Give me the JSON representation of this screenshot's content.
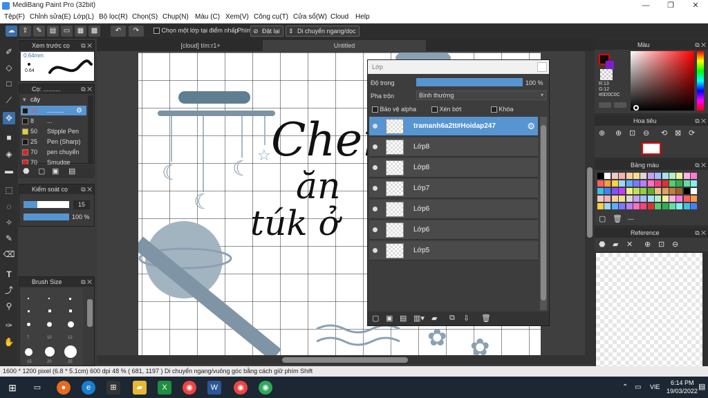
{
  "window": {
    "title": "MediBang Paint Pro (32bit)",
    "minimize": "—",
    "maximize": "❐",
    "close": "✕"
  },
  "menu": [
    "Tệp(F)",
    "Chỉnh sửa(E)",
    "Lớp(L)",
    "Bộ lọc(R)",
    "Chọn(S)",
    "Chụp(N)",
    "Màu (C)",
    "Xem(V)",
    "Công cụ(T)",
    "Cửa sổ(W)",
    "Cloud",
    "Help"
  ],
  "toolbar": {
    "select_layer_label": "Chọn một lớp tại điểm nhấp",
    "key_label": "Phím",
    "reset_label": "Đặt lại",
    "move_label": "Di chuyển ngang/dọc"
  },
  "brush_preview": {
    "title": "Xem trước cọ",
    "size": "0.64mm",
    "dot": "0.64"
  },
  "brush_list": {
    "title": "Cọ: ..........",
    "folder": "cây",
    "items": [
      {
        "size": "15",
        "name": "..........",
        "color": "#1a1a1a"
      },
      {
        "size": "8",
        "name": "...",
        "color": "#1a1a1a"
      },
      {
        "size": "50",
        "name": "Stipple Pen",
        "color": "#e8d22a"
      },
      {
        "size": "25",
        "name": "Pen (Sharp)",
        "color": "#1a1a1a"
      },
      {
        "size": "70",
        "name": "pen chuyển",
        "color": "#e02020"
      },
      {
        "size": "70",
        "name": "Smudge",
        "color": "#e02020"
      }
    ]
  },
  "brush_control": {
    "title": "Kiểm soát cọ",
    "size_value": "15",
    "opacity_value": "100 %",
    "size_level": 0.3,
    "opacity_level": 1.0
  },
  "brush_size": {
    "title": "Brush Size",
    "labels": [
      "7",
      "10",
      "12",
      "15",
      "20",
      "25"
    ]
  },
  "tabs": {
    "tab1": "[cloud] tím:r1+",
    "tab2": "Untitled"
  },
  "canvas": {
    "line1": "Chen",
    "line2": "ăn",
    "line3": "túk ở"
  },
  "layer_panel": {
    "title": "Lớp",
    "opacity_label": "Độ trong",
    "opacity_value": "100 %",
    "opacity_level": 1.0,
    "blend_label": "Pha trộn",
    "blend_value": "Bình thường",
    "protect_alpha": "Bảo vệ alpha",
    "clipping": "Xén bớt",
    "lock": "Khóa",
    "layers": [
      {
        "name": "tramanh6a2tt#Hoidap247",
        "selected": true
      },
      {
        "name": "Lớp8",
        "selected": false
      },
      {
        "name": "Lớp8",
        "selected": false
      },
      {
        "name": "Lớp7",
        "selected": false
      },
      {
        "name": "Lớp6",
        "selected": false
      },
      {
        "name": "Lớp6",
        "selected": false
      },
      {
        "name": "Lớp5",
        "selected": false
      }
    ]
  },
  "color_panel": {
    "title": "Màu",
    "r": "R:13",
    "g": "G:12",
    "b": "#0D0C0C"
  },
  "navigator": {
    "title": "Hoa tiêu"
  },
  "palette": {
    "title": "Bảng màu",
    "dashes": "---"
  },
  "reference": {
    "title": "Reference"
  },
  "status": {
    "text": "1600 * 1200 pixel  (6.8 * 5.1cm)  600 dpi  48 %  ( 681, 1197 )  Di chuyển ngang/vuông góc bằng cách giữ phím Shift"
  },
  "taskbar": {
    "lang": "VIE",
    "time": "6:14 PM",
    "date": "19/03/2022"
  },
  "colors": {
    "accent": "#5795d2",
    "panel": "#3a3a3a",
    "selected_layer": "#5795d2"
  }
}
